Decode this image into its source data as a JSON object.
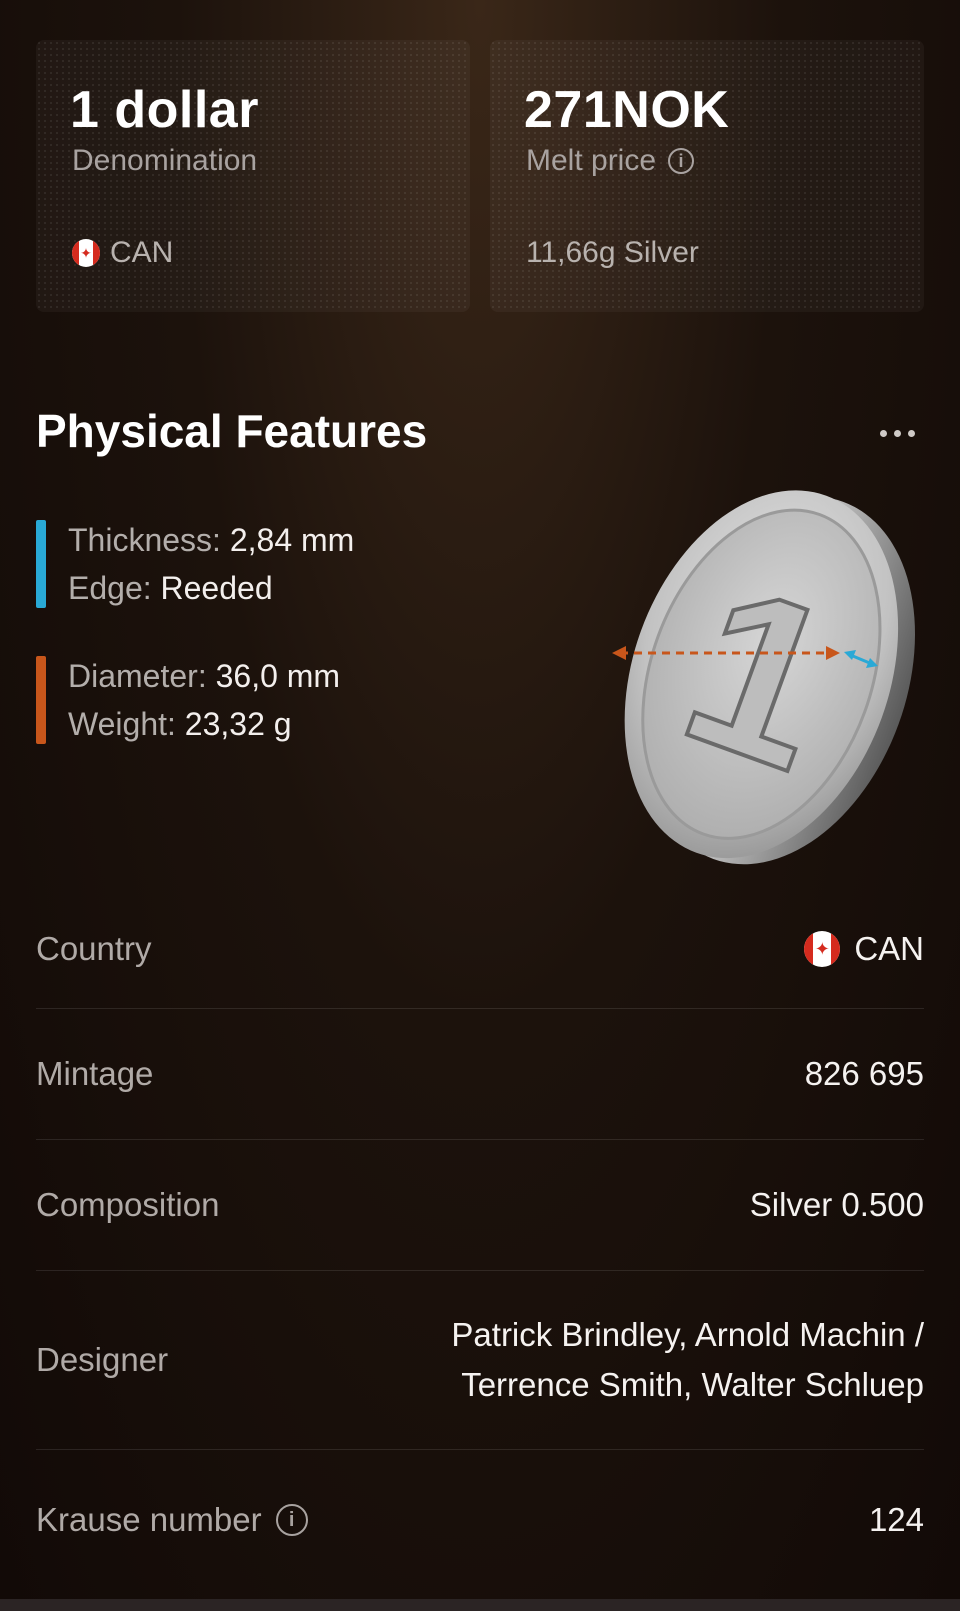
{
  "cards": {
    "denomination": {
      "title": "1 dollar",
      "subtitle": "Denomination",
      "country": "CAN"
    },
    "melt": {
      "title": "271NOK",
      "subtitle": "Melt price",
      "note": "11,66g Silver"
    }
  },
  "section": {
    "title": "Physical Features"
  },
  "features": {
    "group1": {
      "color": "#29a9d6",
      "rows": [
        {
          "key": "Thickness:",
          "value": "2,84 mm"
        },
        {
          "key": "Edge:",
          "value": "Reeded"
        }
      ]
    },
    "group2": {
      "color": "#c8561b",
      "rows": [
        {
          "key": "Diameter:",
          "value": "36,0 mm"
        },
        {
          "key": "Weight:",
          "value": "23,32 g"
        }
      ]
    }
  },
  "coin": {
    "numeral": "1"
  },
  "details": [
    {
      "label": "Country",
      "value": "CAN"
    },
    {
      "label": "Mintage",
      "value": "826 695"
    },
    {
      "label": "Composition",
      "value": "Silver 0.500"
    },
    {
      "label": "Designer",
      "value_lines": [
        "Patrick Brindley, Arnold Machin /",
        "Terrence Smith, Walter Schluep"
      ]
    },
    {
      "label": "Krause number",
      "value": "124"
    }
  ],
  "icons": {
    "info": "info-icon",
    "flag": "canada-flag-icon",
    "more": "more-icon"
  }
}
